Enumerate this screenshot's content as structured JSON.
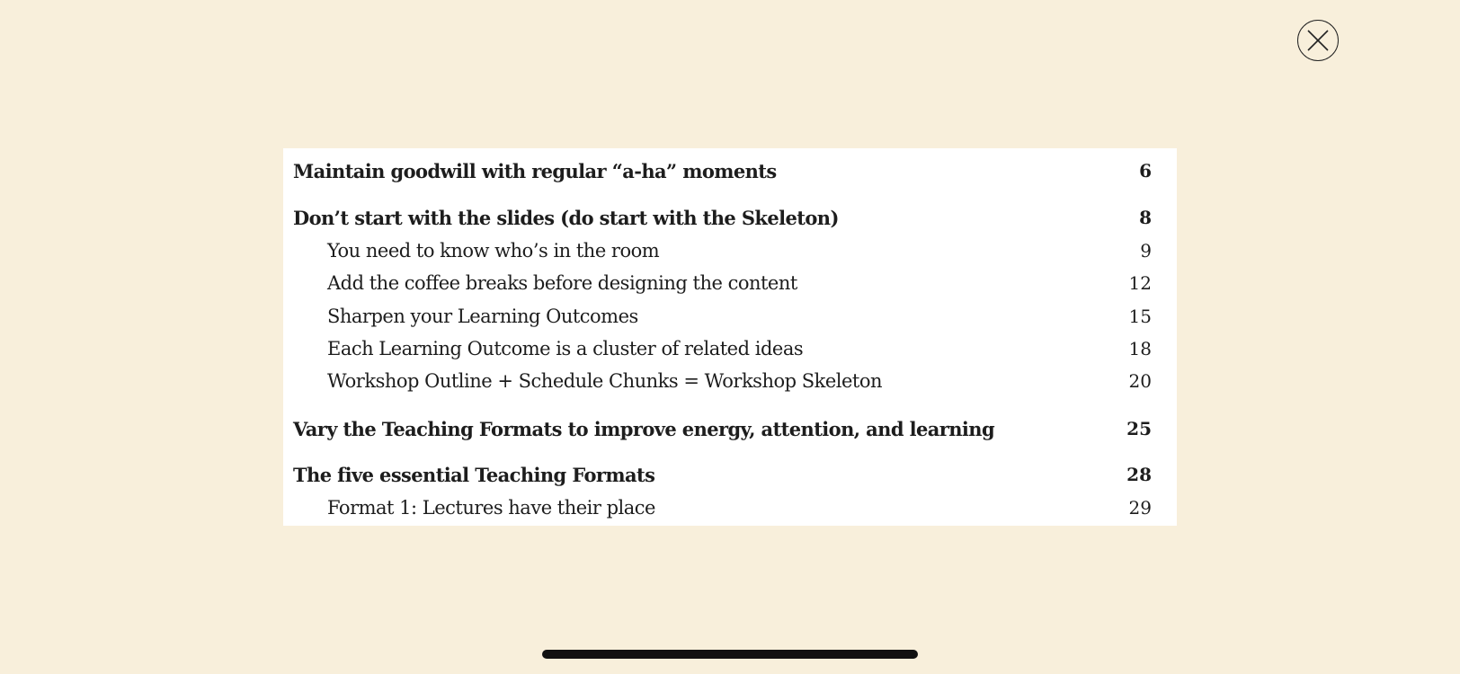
{
  "toc": {
    "entries": [
      {
        "title": "Maintain goodwill with regular “a-ha” moments",
        "page": "6"
      },
      {
        "title": "Don’t start with the slides (do start with the Skeleton)",
        "page": "8"
      },
      {
        "title": "You need to know who’s in the room",
        "page": "9"
      },
      {
        "title": "Add the coffee breaks before designing the content",
        "page": "12"
      },
      {
        "title": "Sharpen your Learning Outcomes",
        "page": "15"
      },
      {
        "title": "Each Learning Outcome is a cluster of related ideas",
        "page": "18"
      },
      {
        "title": "Workshop Outline + Schedule Chunks = Workshop Skeleton",
        "page": "20"
      },
      {
        "title": "Vary the Teaching Formats to improve energy, attention, and learning",
        "page": "25"
      },
      {
        "title": "The five essential Teaching Formats",
        "page": "28"
      },
      {
        "title": "Format 1: Lectures have their place",
        "page": "29"
      }
    ]
  },
  "icons": {
    "close": "close-icon",
    "home_indicator": "home-indicator-bar"
  },
  "colors": {
    "background": "#f8efdb",
    "image_background": "#ffffff",
    "text": "#1d1d1d"
  }
}
